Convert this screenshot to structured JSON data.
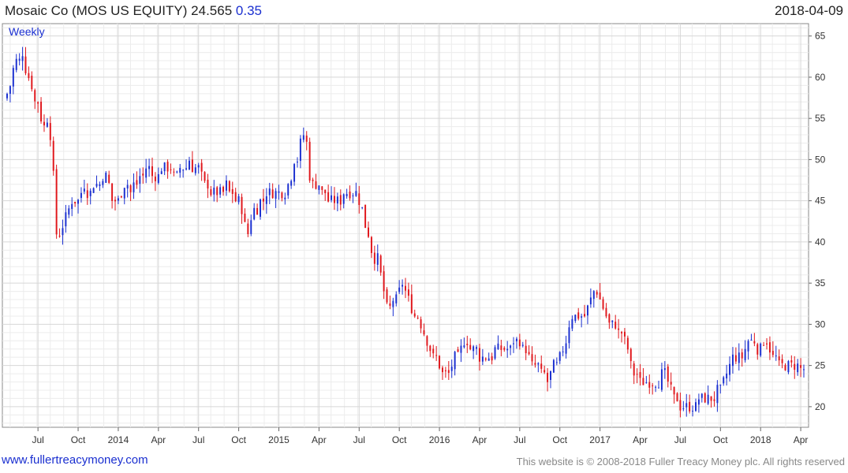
{
  "header": {
    "title": "Mosaic Co (MOS US EQUITY)",
    "price": "24.565",
    "change": "0.35",
    "date": "2018-04-09"
  },
  "footer": {
    "site": "www.fullertreacymoney.com",
    "copyright": "This website is © 2008-2018 Fuller Treacy Money plc. All rights reserved"
  },
  "colors": {
    "up": "#1a2fd0",
    "down": "#e0161b",
    "grid": "#d7d7d7"
  },
  "chart_data": {
    "type": "candlestick",
    "frequency_label": "Weekly",
    "ylim": [
      17.5,
      66.5
    ],
    "y_ticks": [
      20,
      25,
      30,
      35,
      40,
      45,
      50,
      55,
      60,
      65
    ],
    "x_ticks": [
      {
        "label": "Jul",
        "week": 10
      },
      {
        "label": "Oct",
        "week": 23
      },
      {
        "label": "2014",
        "week": 36
      },
      {
        "label": "Apr",
        "week": 49
      },
      {
        "label": "Jul",
        "week": 62
      },
      {
        "label": "Oct",
        "week": 75
      },
      {
        "label": "2015",
        "week": 88
      },
      {
        "label": "Apr",
        "week": 101
      },
      {
        "label": "Jul",
        "week": 114
      },
      {
        "label": "Oct",
        "week": 127
      },
      {
        "label": "2016",
        "week": 140
      },
      {
        "label": "Apr",
        "week": 153
      },
      {
        "label": "Jul",
        "week": 166
      },
      {
        "label": "Oct",
        "week": 179
      },
      {
        "label": "2017",
        "week": 192
      },
      {
        "label": "Apr",
        "week": 205
      },
      {
        "label": "Jul",
        "week": 218
      },
      {
        "label": "Oct",
        "week": 231
      },
      {
        "label": "2018",
        "week": 244
      },
      {
        "label": "Apr",
        "week": 257
      }
    ],
    "weeks_total": 259,
    "close_series": [
      58,
      59,
      61,
      62,
      63,
      61,
      60,
      59,
      57,
      55,
      54,
      55,
      53,
      48,
      41,
      42,
      43,
      44,
      45,
      45,
      46,
      47,
      46,
      46,
      47,
      47,
      48,
      48,
      47,
      45,
      45,
      46,
      47,
      47,
      46,
      47,
      48,
      48,
      49,
      49,
      48,
      48,
      49,
      49,
      49,
      49,
      48,
      49,
      49,
      49,
      50,
      49,
      49,
      48,
      47,
      47,
      46,
      46,
      46,
      46,
      47,
      46,
      46,
      45,
      44,
      42,
      41,
      43,
      44,
      45,
      45,
      46,
      46,
      46,
      46,
      46,
      46,
      47,
      48,
      50,
      52,
      53,
      52,
      48,
      47,
      47,
      46,
      46,
      45,
      45,
      45,
      45,
      46,
      46,
      46,
      46,
      45,
      44,
      42,
      41,
      39,
      38,
      36,
      34,
      32,
      32,
      33,
      34,
      35,
      34,
      33,
      32,
      31,
      30,
      29,
      28,
      27,
      26,
      25,
      24,
      24,
      24,
      25,
      26,
      27,
      28,
      28,
      27,
      27,
      26,
      26,
      26,
      26,
      26,
      27,
      27,
      27,
      27,
      27,
      28,
      28,
      27,
      27,
      26,
      25,
      25,
      24,
      24,
      23,
      24,
      25,
      26,
      27,
      28,
      30,
      31,
      31,
      31,
      31,
      32,
      33,
      34,
      33,
      32,
      31,
      30,
      30,
      29,
      29,
      28,
      27,
      25,
      24,
      23,
      23,
      23,
      23,
      23,
      23,
      24,
      24,
      23,
      22,
      21,
      20,
      20,
      20,
      20,
      20,
      21,
      21,
      21,
      21,
      21,
      22,
      22,
      23,
      24,
      25,
      26,
      26,
      26,
      27,
      28,
      28,
      27,
      27,
      28,
      28,
      27,
      26,
      25,
      25,
      25,
      25,
      25,
      25,
      24.6,
      24.565
    ]
  }
}
